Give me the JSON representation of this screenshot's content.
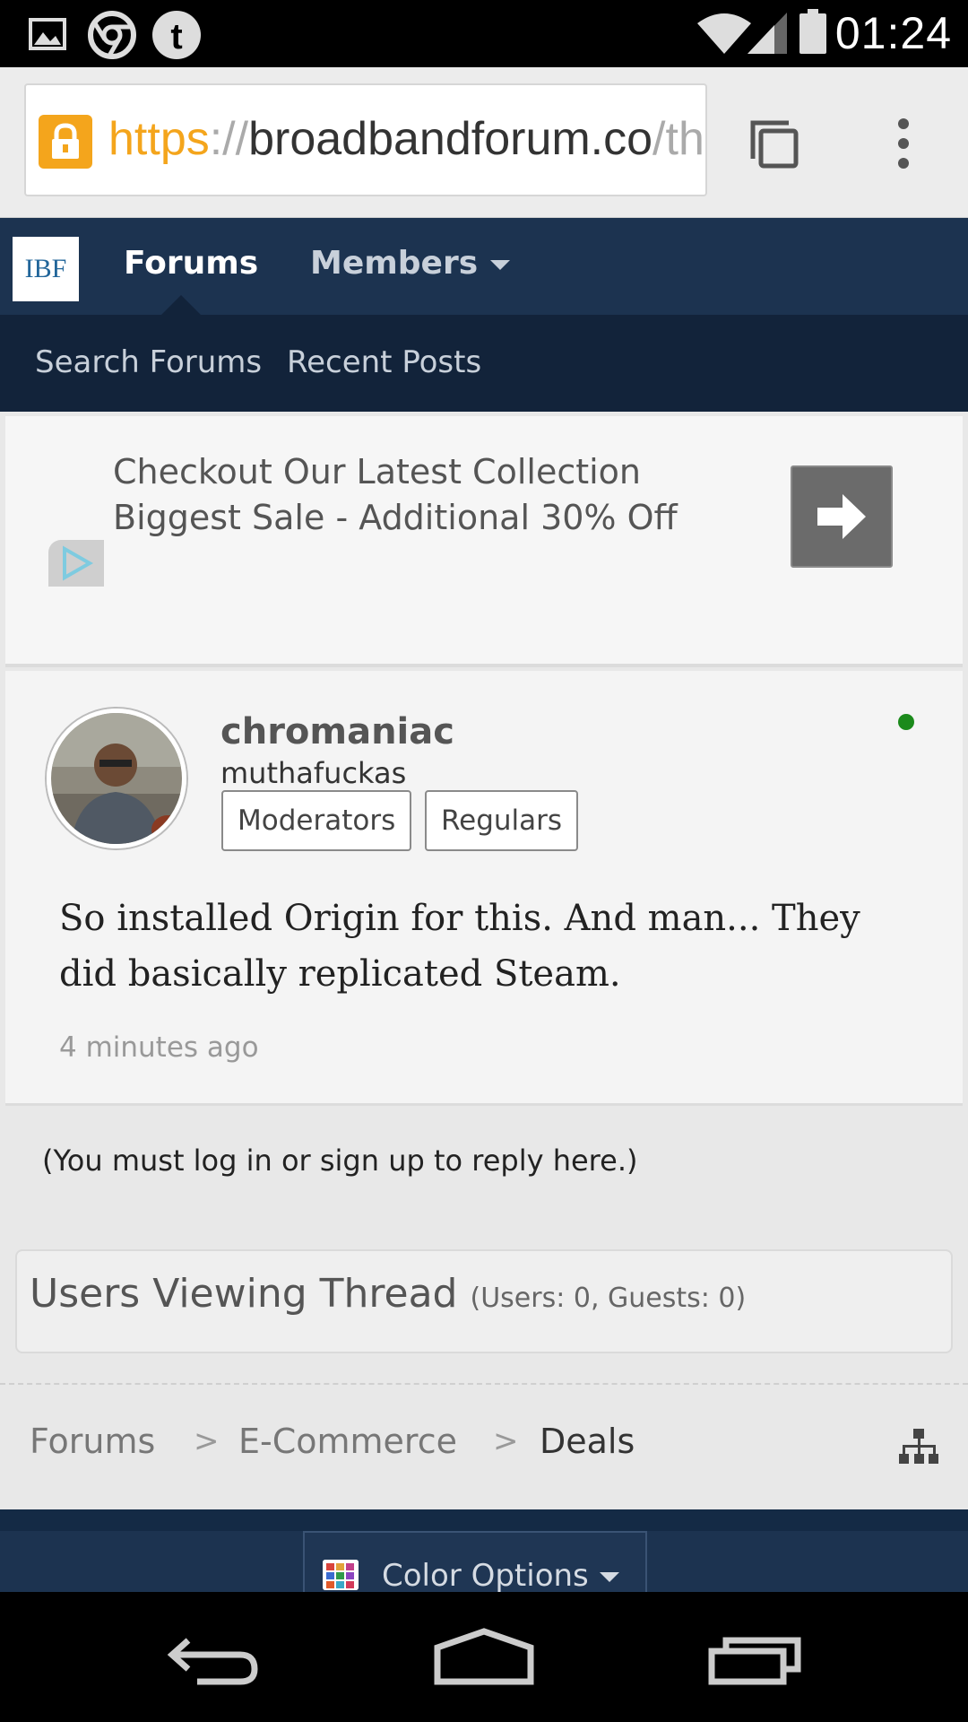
{
  "status_bar": {
    "time": "01:24",
    "left_icons": [
      "image-notification-icon",
      "chrome-notification-icon",
      "tumblr-notification-icon"
    ],
    "right_icons": [
      "wifi-icon",
      "cell-signal-icon",
      "battery-icon"
    ]
  },
  "browser": {
    "url_scheme": "https",
    "url_sep": "://",
    "url_host": "broadbandforum.co",
    "url_path": "/th",
    "accent_color": "#f4a51c"
  },
  "site_nav": {
    "logo_text": "IBF",
    "tabs": [
      {
        "label": "Forums",
        "active": true
      },
      {
        "label": "Members",
        "active": false
      }
    ],
    "sub_links": [
      "Search Forums",
      "Recent Posts"
    ]
  },
  "ad": {
    "line1": "Checkout Our Latest Collection",
    "line2": "Biggest Sale - Additional 30% Off"
  },
  "post": {
    "username": "chromaniac",
    "user_title": "muthafuckas",
    "badges": [
      "Moderators",
      "Regulars"
    ],
    "online": true,
    "message": "So installed Origin for this. And man... They did basically replicated Steam.",
    "timestamp": "4 minutes ago"
  },
  "login_note": "(You must log in or sign up to reply here.)",
  "viewers": {
    "title": "Users Viewing Thread",
    "counts": "(Users: 0, Guests: 0)"
  },
  "breadcrumb": {
    "items": [
      "Forums",
      "E-Commerce",
      "Deals"
    ],
    "separator": ">"
  },
  "footer": {
    "color_options_label": "Color Options"
  },
  "colors": {
    "nav_bg": "#1c3350",
    "subnav_bg": "#12233a",
    "online": "#1b8a1b"
  }
}
